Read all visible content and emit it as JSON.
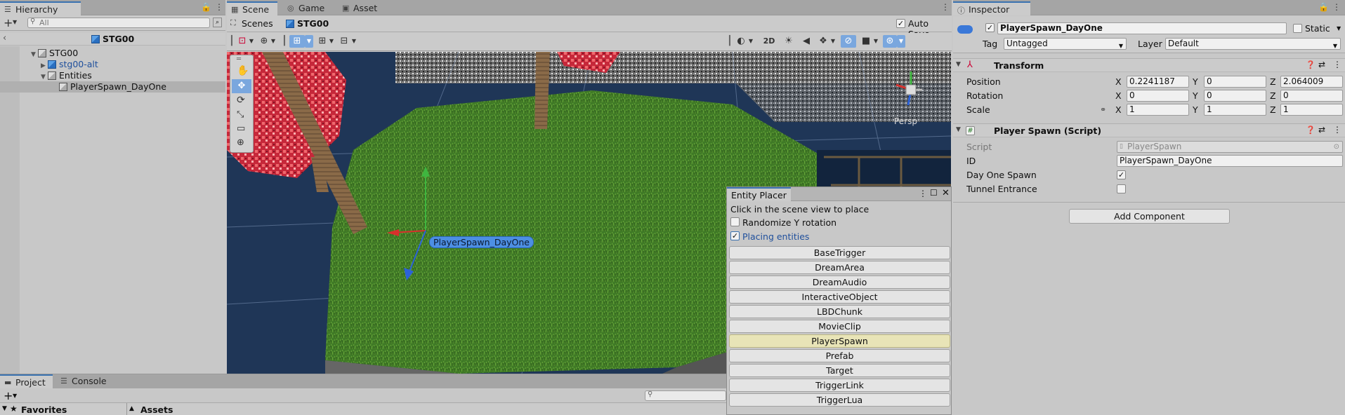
{
  "hierarchy": {
    "tab_label": "Hierarchy",
    "search_placeholder": "All",
    "scene_title": "STG00",
    "items": [
      {
        "label": "STG00"
      },
      {
        "label": "stg00-alt"
      },
      {
        "label": "Entities"
      },
      {
        "label": "PlayerSpawn_DayOne"
      }
    ]
  },
  "scene": {
    "tabs": [
      {
        "label": "Scene"
      },
      {
        "label": "Game"
      },
      {
        "label": "Asset Store"
      }
    ],
    "breadcrumb_root": "Scenes",
    "breadcrumb_current": "STG00",
    "auto_save_label": "Auto Save",
    "auto_save_checked": true,
    "mode_2d_label": "2D",
    "persp_label": "Persp",
    "selected_object_label": "PlayerSpawn_DayOne"
  },
  "entity_placer": {
    "title": "Entity Placer",
    "instruction": "Click in the scene view to place",
    "randomize_label": "Randomize Y rotation",
    "randomize_checked": false,
    "placing_label": "Placing entities",
    "placing_checked": true,
    "buttons": [
      {
        "label": "BaseTrigger"
      },
      {
        "label": "DreamArea"
      },
      {
        "label": "DreamAudio"
      },
      {
        "label": "InteractiveObject"
      },
      {
        "label": "LBDChunk"
      },
      {
        "label": "MovieClip"
      },
      {
        "label": "PlayerSpawn",
        "highlighted": true
      },
      {
        "label": "Prefab"
      },
      {
        "label": "Target"
      },
      {
        "label": "TriggerLink"
      },
      {
        "label": "TriggerLua"
      }
    ]
  },
  "inspector": {
    "tab_label": "Inspector",
    "object_name": "PlayerSpawn_DayOne",
    "static_label": "Static",
    "tag_label": "Tag",
    "tag_value": "Untagged",
    "layer_label": "Layer",
    "layer_value": "Default",
    "transform": {
      "title": "Transform",
      "position_label": "Position",
      "rotation_label": "Rotation",
      "scale_label": "Scale",
      "x_label": "X",
      "y_label": "Y",
      "z_label": "Z",
      "position": {
        "x": "0.2241187",
        "y": "0",
        "z": "2.064009"
      },
      "rotation": {
        "x": "0",
        "y": "0",
        "z": "0"
      },
      "scale": {
        "x": "1",
        "y": "1",
        "z": "1"
      }
    },
    "player_spawn": {
      "title": "Player Spawn (Script)",
      "script_label": "Script",
      "script_value": "PlayerSpawn",
      "id_label": "ID",
      "id_value": "PlayerSpawn_DayOne",
      "day_one_label": "Day One Spawn",
      "day_one_checked": true,
      "tunnel_label": "Tunnel Entrance",
      "tunnel_checked": false
    },
    "add_component_label": "Add Component"
  },
  "project": {
    "tabs": [
      {
        "label": "Project"
      },
      {
        "label": "Console"
      }
    ],
    "favorites_label": "Favorites",
    "assets_label": "Assets"
  },
  "colors": {
    "accent": "#3a72b0",
    "panel_bg": "#c2c2c2",
    "highlight_button": "#e8e4b7",
    "selection": "#b0b0b0"
  }
}
